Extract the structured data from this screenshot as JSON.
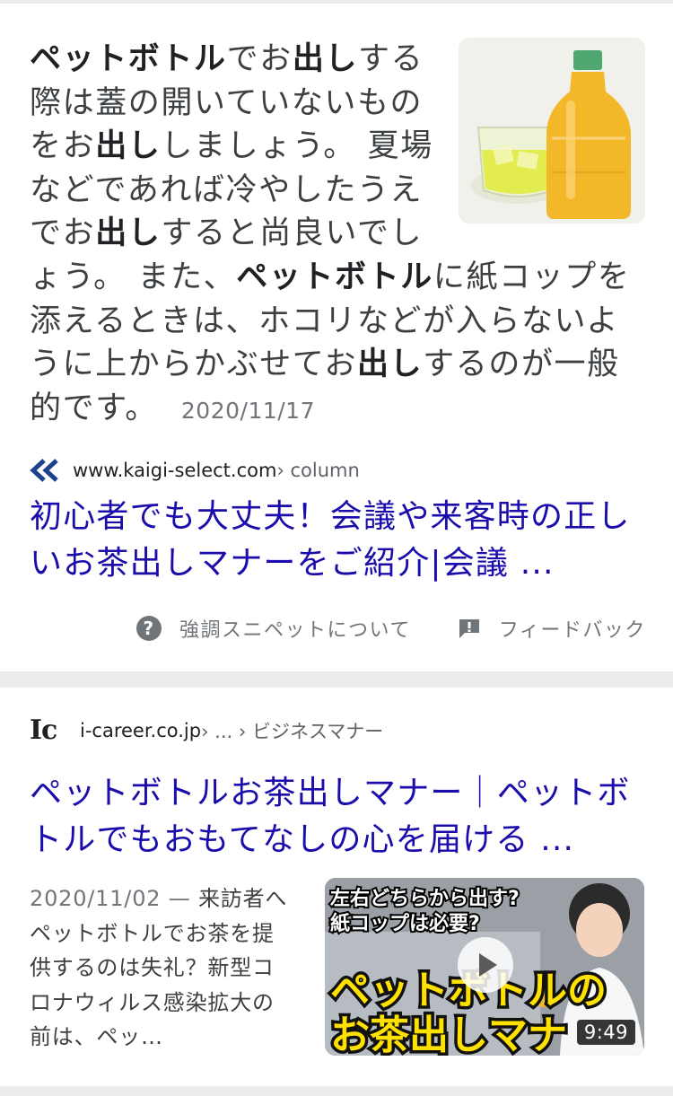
{
  "featured_snippet": {
    "parts": [
      {
        "t": "ペットボトル",
        "b": true
      },
      {
        "t": "でお",
        "b": false
      },
      {
        "t": "出し",
        "b": true
      },
      {
        "t": "する際は蓋の開いていないものをお",
        "b": false
      },
      {
        "t": "出し",
        "b": true
      },
      {
        "t": "しましょう。 夏場などであれば冷やしたうえでお",
        "b": false
      },
      {
        "t": "出し",
        "b": true
      },
      {
        "t": "すると尚良いでしょう。 また、",
        "b": false
      },
      {
        "t": "ペットボトル",
        "b": true
      },
      {
        "t": "に紙コップを添えるときは、ホコリなどが入らないように上からかぶせてお",
        "b": false
      },
      {
        "t": "出し",
        "b": true
      },
      {
        "t": "するのが一般的です。",
        "b": false
      }
    ],
    "date": "2020/11/17",
    "image_icon": "tea-bottle-and-glass-image"
  },
  "result1": {
    "site": "www.kaigi-select.com",
    "crumb": " › column",
    "favicon": "double-chevron-logo-icon",
    "title": "初心者でも大丈夫！会議や来客時の正しいお茶出しマナーをご紹介|会議 ..."
  },
  "feedback": {
    "about_label": "強調スニペットについて",
    "feedback_label": "フィードバック"
  },
  "result2": {
    "logo_text": "Ic",
    "site": "i-career.co.jp",
    "crumb": " › ... › ビジネスマナー",
    "title": "ペットボトルお茶出しマナー｜ペットボトルでもおもてなしの心を届ける ...",
    "date": "2020/11/02",
    "separator": " — ",
    "description": "来訪者へペットボトルでお茶を提供するのは失礼？新型コロナウィルス感染拡大の前は、ペッ…",
    "video": {
      "caption_line1": "左右どちらから出す?",
      "caption_line2": "紙コップは必要?",
      "big_line1": "ペットボトルの",
      "big_line2": "お茶出しマナ",
      "duration": "9:49"
    }
  },
  "colors": {
    "link": "#1a0dab",
    "muted": "#70757a",
    "page_bg": "#ececec",
    "card_bg": "#ffffff"
  }
}
